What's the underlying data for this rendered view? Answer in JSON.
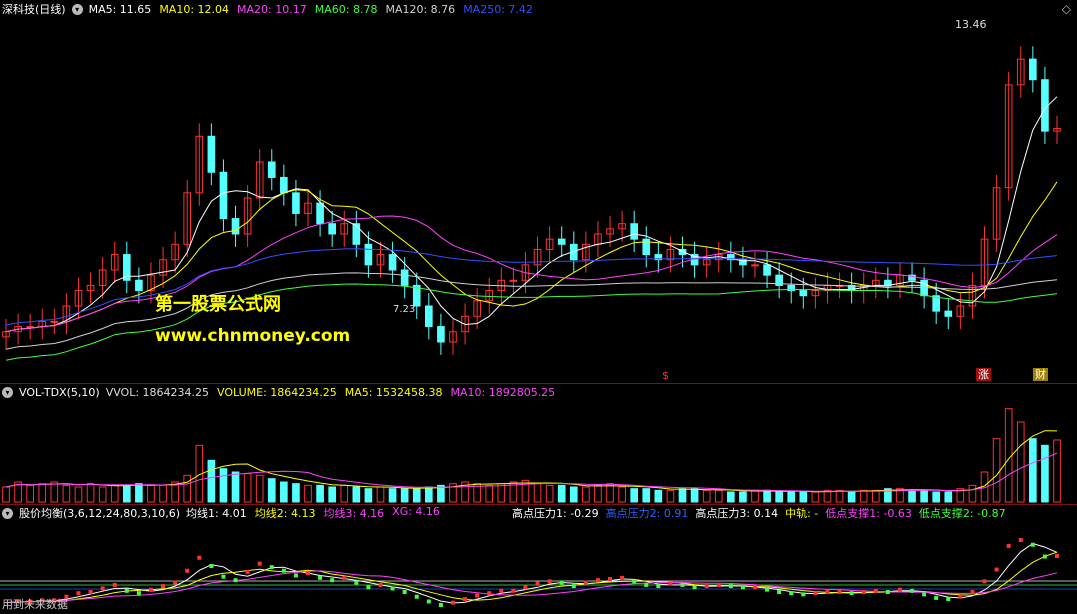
{
  "main": {
    "title": "深科技(日线)",
    "ma": [
      {
        "text": "MA5: 11.65",
        "color": "#ffffff"
      },
      {
        "text": "MA10: 12.04",
        "color": "#ffff00"
      },
      {
        "text": "MA20: 10.17",
        "color": "#ff40ff"
      },
      {
        "text": "MA60: 8.78",
        "color": "#40ff40"
      },
      {
        "text": "MA120: 8.76",
        "color": "#d0d0d0"
      },
      {
        "text": "MA250: 7.42",
        "color": "#3050ff"
      }
    ],
    "high_label": "13.46",
    "low_label": "7.23",
    "watermark1": "第一股票公式网",
    "watermark2": "www.chnmoney.com",
    "marker_s": "$",
    "marker_zhang": "涨",
    "marker_caibao": "财"
  },
  "vol": {
    "name": "VOL-TDX(5,10)",
    "values": [
      {
        "text": "VVOL: 1864234.25",
        "color": "#dddddd"
      },
      {
        "text": "VOLUME: 1864234.25",
        "color": "#ffff00"
      },
      {
        "text": "MA5: 1532458.38",
        "color": "#ffff00"
      },
      {
        "text": "MA10: 1892805.25",
        "color": "#ff40ff"
      }
    ]
  },
  "ind": {
    "name": "股价均衡(3,6,12,24,80,3,10,6)",
    "values": [
      {
        "text": "均线1: 4.01",
        "color": "#ffffff"
      },
      {
        "text": "均线2: 4.13",
        "color": "#ffff00"
      },
      {
        "text": "均线3: 4.16",
        "color": "#ff40ff"
      },
      {
        "text": "XG: 4.16",
        "color": "#ff40ff"
      }
    ],
    "levels": [
      {
        "text": "高点压力1: -0.29",
        "color": "#ffffff"
      },
      {
        "text": "高点压力2: 0.91",
        "color": "#3060ff"
      },
      {
        "text": "高点压力3: 0.14",
        "color": "#ffffff"
      },
      {
        "text": "中轨: -",
        "color": "#ffff00"
      },
      {
        "text": "低点支撑1: -0.63",
        "color": "#ff40ff"
      },
      {
        "text": "低点支撑2: -0.87",
        "color": "#40ff40"
      }
    ],
    "footer": "用到未来数据"
  },
  "chart_data": {
    "type": "candlestick",
    "close": [
      7.7,
      7.8,
      7.8,
      7.9,
      7.9,
      8.2,
      8.5,
      8.6,
      8.9,
      9.2,
      8.7,
      8.5,
      8.8,
      9.1,
      9.4,
      10.4,
      11.5,
      10.8,
      9.9,
      9.6,
      10.3,
      11.0,
      10.7,
      10.4,
      10.0,
      10.2,
      9.8,
      9.6,
      9.8,
      9.4,
      9.0,
      9.2,
      8.9,
      8.6,
      8.2,
      7.8,
      7.5,
      7.7,
      8.0,
      8.3,
      8.5,
      8.7,
      8.7,
      9.0,
      9.3,
      9.5,
      9.4,
      9.1,
      9.4,
      9.6,
      9.7,
      9.8,
      9.5,
      9.2,
      9.1,
      9.3,
      9.2,
      9.0,
      9.1,
      9.2,
      9.1,
      9.0,
      9.0,
      8.8,
      8.6,
      8.5,
      8.4,
      8.5,
      8.6,
      8.6,
      8.5,
      8.6,
      8.7,
      8.6,
      8.8,
      8.7,
      8.4,
      8.1,
      8.0,
      8.2,
      8.6,
      9.5,
      10.5,
      12.5,
      13.0,
      12.6,
      11.6,
      11.65
    ],
    "volume": [
      0.45,
      0.6,
      0.5,
      0.55,
      0.6,
      0.5,
      0.45,
      0.55,
      0.45,
      0.5,
      0.5,
      0.55,
      0.5,
      0.5,
      0.6,
      0.8,
      1.7,
      1.25,
      1.0,
      0.9,
      0.85,
      0.8,
      0.7,
      0.6,
      0.55,
      0.5,
      0.5,
      0.45,
      0.5,
      0.45,
      0.4,
      0.45,
      0.4,
      0.4,
      0.4,
      0.45,
      0.5,
      0.55,
      0.6,
      0.55,
      0.5,
      0.55,
      0.6,
      0.65,
      0.55,
      0.5,
      0.5,
      0.45,
      0.45,
      0.5,
      0.55,
      0.45,
      0.4,
      0.4,
      0.35,
      0.35,
      0.4,
      0.4,
      0.35,
      0.35,
      0.3,
      0.3,
      0.35,
      0.35,
      0.3,
      0.3,
      0.3,
      0.3,
      0.35,
      0.35,
      0.3,
      0.35,
      0.35,
      0.4,
      0.4,
      0.35,
      0.35,
      0.3,
      0.3,
      0.4,
      0.5,
      0.9,
      1.9,
      2.8,
      2.4,
      1.9,
      1.7,
      1.86
    ],
    "price_range": [
      6.8,
      13.8
    ],
    "volume_unit": "M"
  }
}
